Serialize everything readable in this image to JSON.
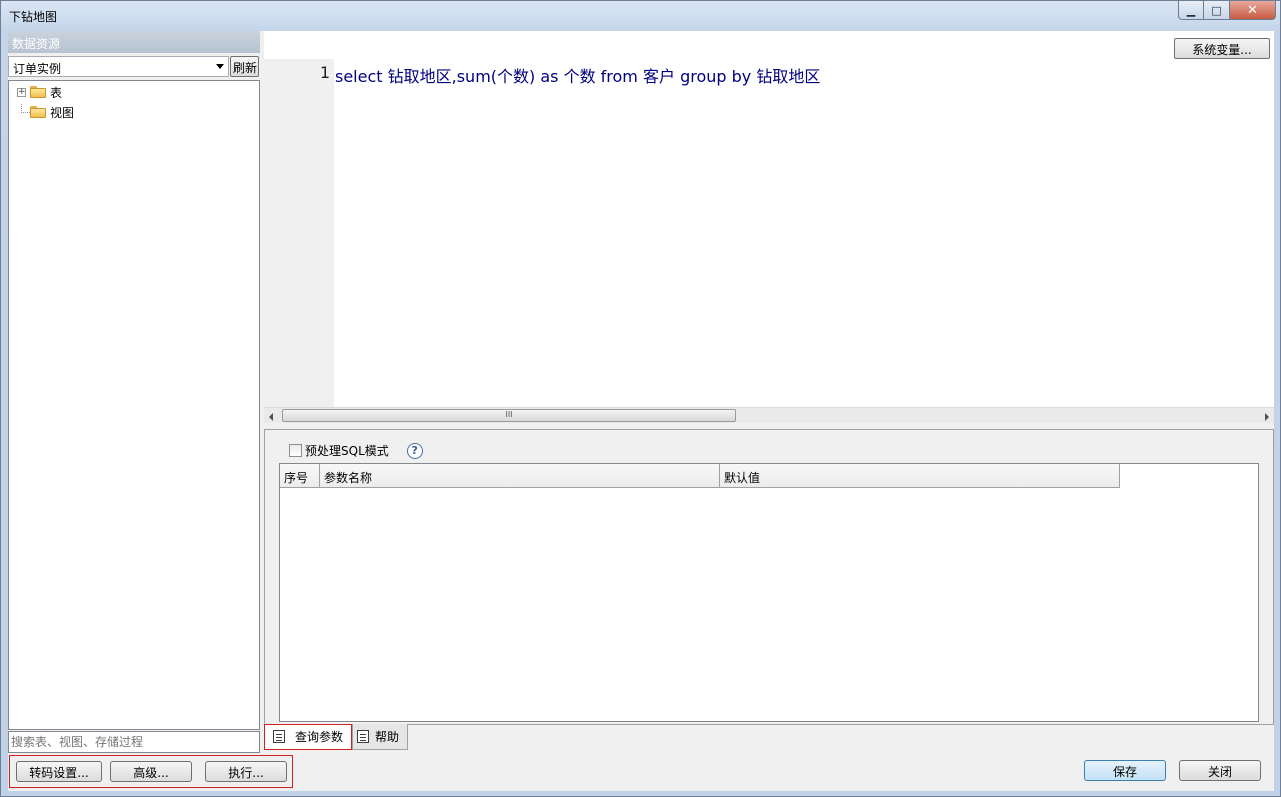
{
  "window": {
    "title": "下钻地图",
    "minimize": "▁",
    "maximize": "□",
    "close": "✕"
  },
  "left": {
    "header": "数据资源",
    "datasource": "订单实例",
    "refresh_label": "刷新",
    "tree": [
      {
        "label": "表",
        "expandable": "+"
      },
      {
        "label": "视图"
      }
    ],
    "search_placeholder": "搜索表、视图、存储过程"
  },
  "editor": {
    "system_vars_label": "系统变量...",
    "lines": [
      {
        "number": "1",
        "text": "select 钻取地区,sum(个数) as 个数 from 客户 group by 钻取地区"
      }
    ],
    "scroll_grip": "III"
  },
  "params": {
    "preprocess_label": "预处理SQL模式",
    "help_glyph": "?",
    "columns": [
      "序号",
      "参数名称",
      "默认值"
    ]
  },
  "tabs": [
    {
      "label": "查询参数"
    },
    {
      "label": "帮助"
    }
  ],
  "buttons": {
    "encoding": "转码设置...",
    "advanced": "高级...",
    "execute": "执行...",
    "save": "保存",
    "close": "关闭"
  }
}
